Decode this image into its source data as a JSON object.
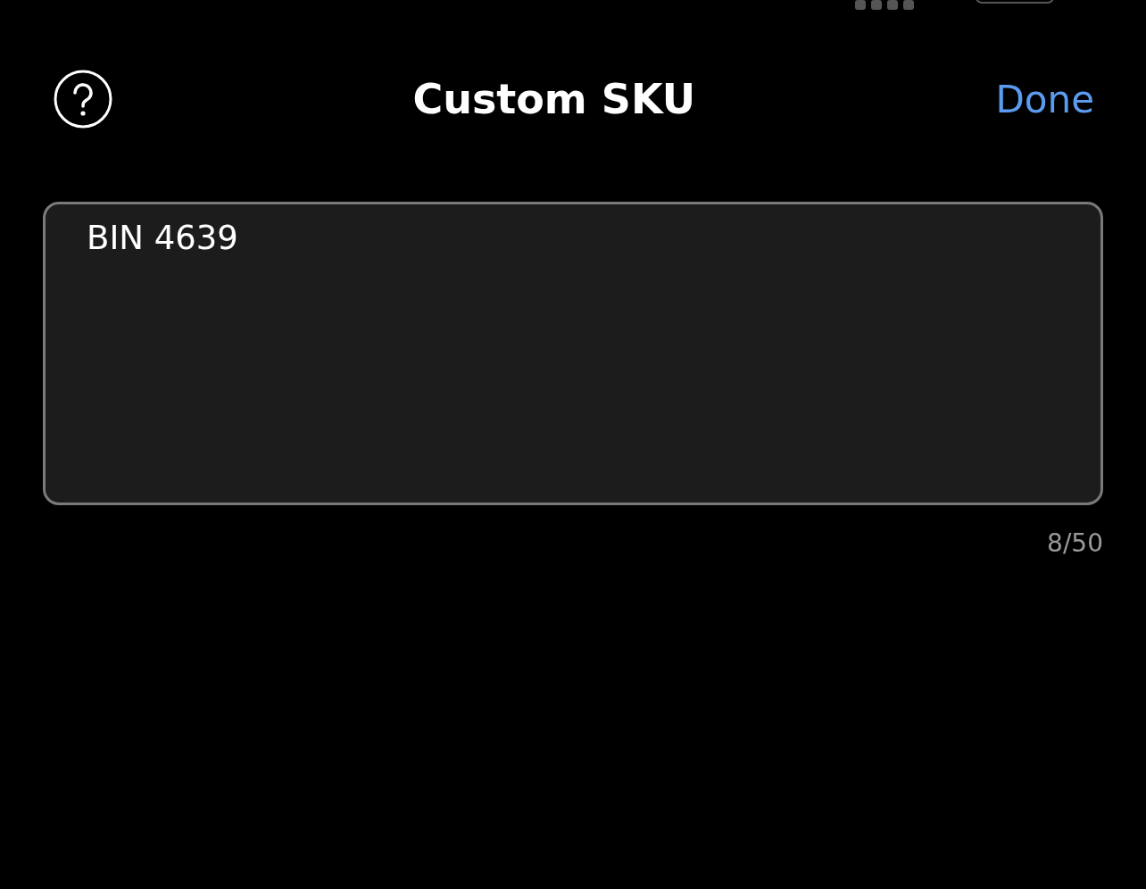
{
  "header": {
    "title": "Custom SKU",
    "action": "Done"
  },
  "field": {
    "value": "BIN 4639"
  },
  "counter": "8/50"
}
